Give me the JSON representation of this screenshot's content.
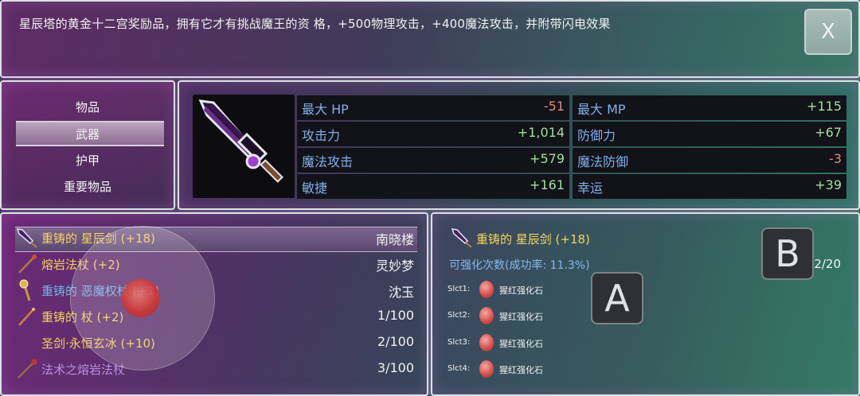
{
  "description": "星辰塔的黄金十二宫奖励品，拥有它才有挑战魔王的资 格，+500物理攻击，+400魔法攻击，并附带闪电效果",
  "close_label": "X",
  "categories": [
    {
      "label": "物品"
    },
    {
      "label": "武器"
    },
    {
      "label": "护甲"
    },
    {
      "label": "重要物品"
    }
  ],
  "selected_category": "武器",
  "stats": [
    {
      "label": "最大 HP",
      "value": "-51",
      "sign": "neg"
    },
    {
      "label": "最大 MP",
      "value": "+115",
      "sign": "pos"
    },
    {
      "label": "攻击力",
      "value": "+1,014",
      "sign": "pos"
    },
    {
      "label": "防御力",
      "value": "+67",
      "sign": "pos"
    },
    {
      "label": "魔法攻击",
      "value": "+579",
      "sign": "pos"
    },
    {
      "label": "魔法防御",
      "value": "-3",
      "sign": "neg"
    },
    {
      "label": "敏捷",
      "value": "+161",
      "sign": "pos"
    },
    {
      "label": "幸运",
      "value": "+39",
      "sign": "pos"
    }
  ],
  "items": [
    {
      "name": "重铸的 星辰剑 (+18)",
      "owner": "南晓楼",
      "color": "#f3d35a",
      "icon": "star-sword-icon"
    },
    {
      "name": "熔岩法杖 (+2)",
      "owner": "灵妙梦",
      "color": "#f3d35a",
      "icon": "lava-staff-icon"
    },
    {
      "name": "重铸的 恶魔权杖 (+1)",
      "owner": "沈玉",
      "color": "#6fb6e6",
      "icon": "demon-scepter-icon"
    },
    {
      "name": "重铸的 杖 (+2)",
      "owner": "1/100",
      "color": "#f3d35a",
      "icon": "staff-icon"
    },
    {
      "name": "圣剑·永恒玄冰 (+10)",
      "owner": "2/100",
      "color": "#f3d35a",
      "icon": ""
    },
    {
      "name": "法术之熔岩法杖",
      "owner": "3/100",
      "color": "#b98ee0",
      "icon": "spell-lava-staff-icon"
    }
  ],
  "forge": {
    "item_name": "重铸的 星辰剑 (+18)",
    "enhance_label": "可强化次数(成功率: 11.3%)",
    "enhance_count": "2/20",
    "slots": [
      {
        "label": "Slct1:",
        "stone": "猩红强化石"
      },
      {
        "label": "Slct2:",
        "stone": "猩红强化石"
      },
      {
        "label": "Slct3:",
        "stone": "猩红强化石"
      },
      {
        "label": "Slct4:",
        "stone": "猩红强化石"
      }
    ]
  },
  "buttons": {
    "a": "A",
    "b": "B"
  },
  "colors": {
    "positive": "#9fe19e",
    "negative": "#de8d7c",
    "stat_label": "#7fb0ea",
    "gold": "#f3d35a"
  }
}
